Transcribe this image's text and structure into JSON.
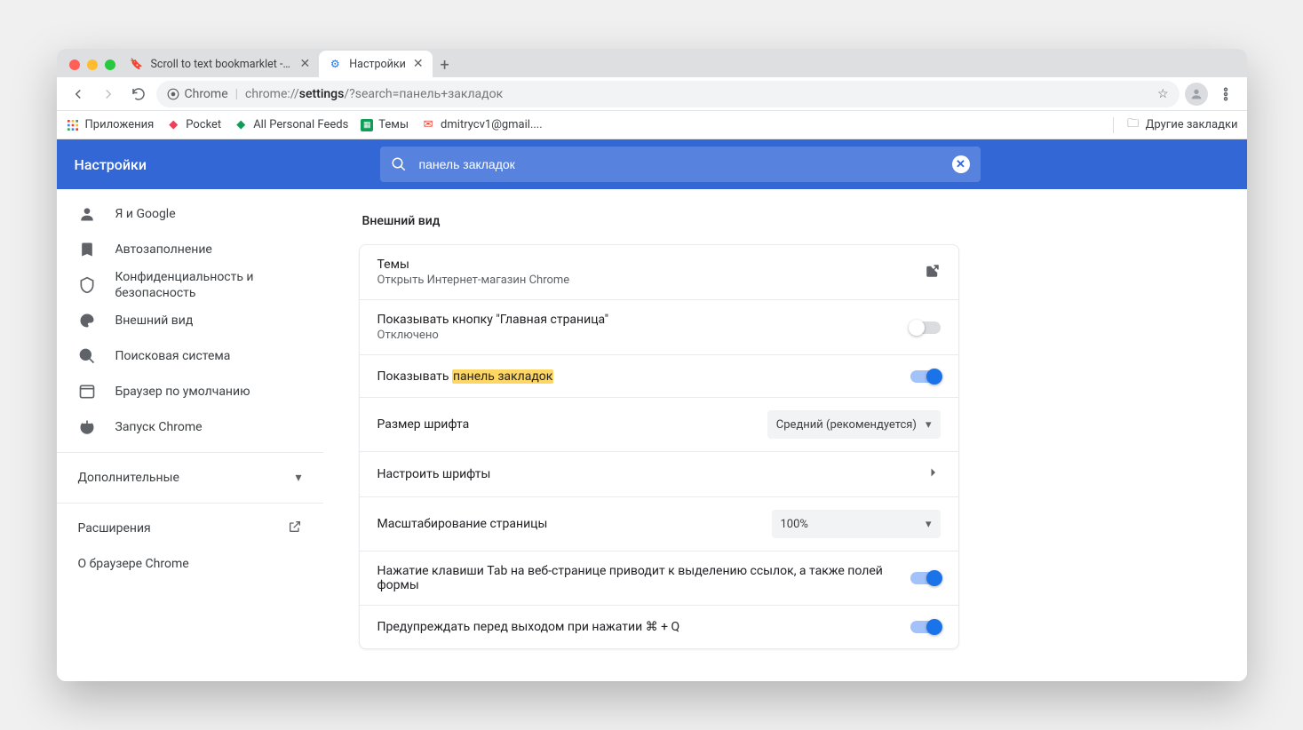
{
  "tabs": [
    {
      "title": "Scroll to text bookmarklet - Mo"
    },
    {
      "title": "Настройки"
    }
  ],
  "omnibox": {
    "chip": "Chrome",
    "url_prefix": "chrome://",
    "url_bold": "settings",
    "url_suffix": "/?search=панель+закладок"
  },
  "bookmarks": {
    "apps": "Приложения",
    "pocket": "Pocket",
    "feeds": "All Personal Feeds",
    "themes": "Темы",
    "gmail": "dmitrycv1@gmail....",
    "other": "Другие закладки"
  },
  "header": {
    "title": "Настройки",
    "search_value": "панель закладок"
  },
  "sidebar": {
    "items": [
      {
        "label": "Я и Google"
      },
      {
        "label": "Автозаполнение"
      },
      {
        "label": "Конфиденциальность и безопасность"
      },
      {
        "label": "Внешний вид"
      },
      {
        "label": "Поисковая система"
      },
      {
        "label": "Браузер по умолчанию"
      },
      {
        "label": "Запуск Chrome"
      }
    ],
    "advanced": "Дополнительные",
    "extensions": "Расширения",
    "about": "О браузере Chrome"
  },
  "content": {
    "section_title": "Внешний вид",
    "themes_title": "Темы",
    "themes_sub": "Открыть Интернет-магазин Chrome",
    "homebtn_title": "Показывать кнопку \"Главная страница\"",
    "homebtn_sub": "Отключено",
    "bmtoggle_prefix": "Показывать ",
    "bmtoggle_highlight": "панель закладок",
    "fontsize_label": "Размер шрифта",
    "fontsize_value": "Средний (рекомендуется)",
    "customfonts": "Настроить шрифты",
    "zoom_label": "Масштабирование страницы",
    "zoom_value": "100%",
    "tab_highlight": "Нажатие клавиши Tab на веб-странице приводит к выделению ссылок, а также полей формы",
    "warn_quit": "Предупреждать перед выходом при нажатии ⌘ + Q"
  }
}
